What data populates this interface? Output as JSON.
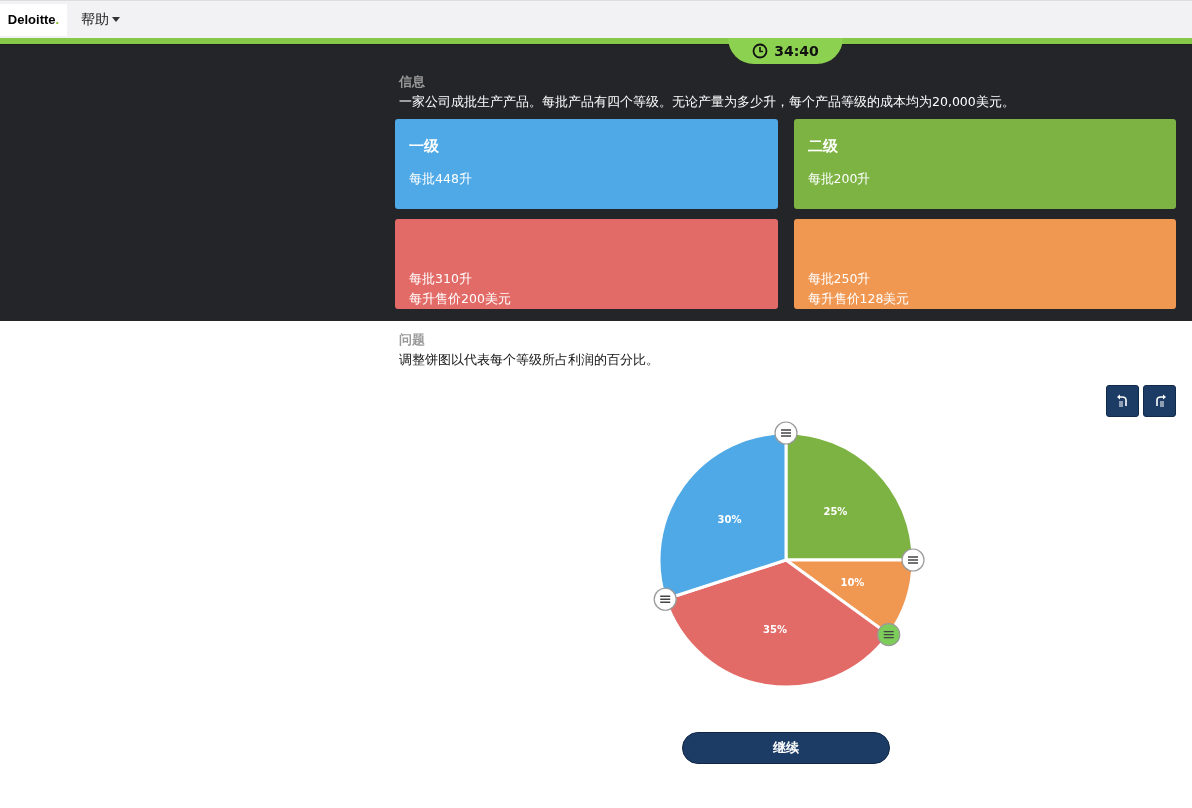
{
  "navbar": {
    "logo": "Deloitte",
    "logo_dot": ".",
    "menu": {
      "label": "帮助"
    }
  },
  "timer": {
    "time": "34:40"
  },
  "info": {
    "heading": "信息",
    "text": "一家公司成批生产产品。每批产品有四个等级。无论产量为多少升，每个产品等级的成本均为20,000美元。"
  },
  "cards": [
    {
      "title": "一级",
      "lines": [
        "每批448升"
      ],
      "color": "#4fa9e6"
    },
    {
      "title": "二级",
      "lines": [
        "每批200升"
      ],
      "color": "#7cb342"
    },
    {
      "lines": [
        "每批310升",
        "每升售价200美元"
      ],
      "color": "#e26b67"
    },
    {
      "lines": [
        "每批250升",
        "每升售价128美元"
      ],
      "color": "#f09752"
    }
  ],
  "question": {
    "heading": "问题",
    "text": "调整饼图以代表每个等级所占利润的百分比。"
  },
  "tools": [
    {
      "kind": "undo"
    },
    {
      "kind": "redo"
    }
  ],
  "pie": {
    "chart_data": {
      "type": "pie",
      "values": [
        25,
        10,
        35,
        30
      ],
      "data_labels": true,
      "value_labels": [
        "25%",
        "10%",
        "35%",
        "30%"
      ],
      "colors": [
        "#7cb342",
        "#f09752",
        "#e26b67",
        "#4fa9e6"
      ]
    },
    "handles": [
      {
        "selected": false
      },
      {
        "selected": false
      },
      {
        "selected": true
      },
      {
        "selected": false
      }
    ]
  },
  "continue_button": {
    "label": "继续"
  }
}
